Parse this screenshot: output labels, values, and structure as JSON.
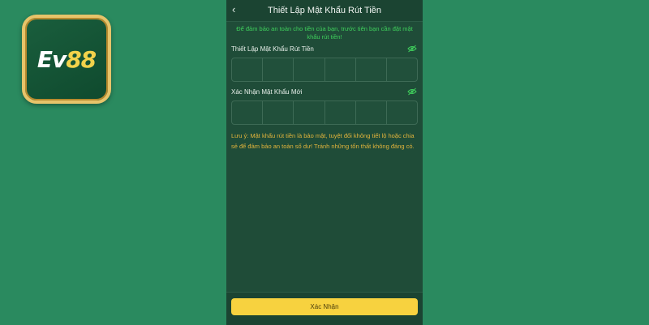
{
  "brand": {
    "logo_text": "Ev",
    "logo_number": "88"
  },
  "header": {
    "title": "Thiết Lập Mật Khẩu Rút Tiền",
    "back_icon": "chevron-left-icon"
  },
  "notice": "Để đảm bảo an toàn cho tiền của bạn, trước tiên bạn cần đặt mật khẩu rút tiền!",
  "fields": [
    {
      "label": "Thiết Lập Mật Khẩu Rút Tiền",
      "cells": 6,
      "icon": "eye-off-icon"
    },
    {
      "label": "Xác Nhận Mật Khẩu Mới",
      "cells": 6,
      "icon": "eye-off-icon"
    }
  ],
  "note": "Lưu ý: Mật khẩu rút tiền là bảo mật, tuyệt đối không tiết lộ hoặc chia sẻ để đảm bảo an toàn số dư! Tránh những tổn thất không đáng có.",
  "footer": {
    "confirm_label": "Xác Nhận"
  },
  "colors": {
    "background": "#2a8a5f",
    "panel": "#1f4c38",
    "notice": "#3fcf5c",
    "note": "#e2b43c",
    "button": "#f7d23f",
    "logo_border": "#e7c46a"
  }
}
